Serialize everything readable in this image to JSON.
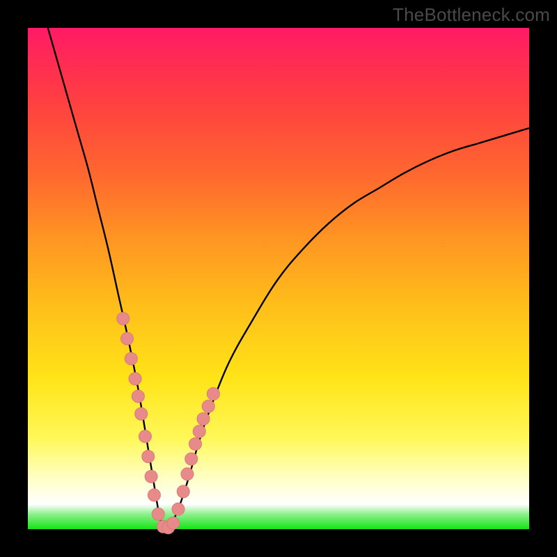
{
  "watermark": "TheBottleneck.com",
  "colors": {
    "curve_stroke": "#000000",
    "dot_fill": "#e98a8a",
    "dot_stroke": "#d97a7a"
  },
  "chart_data": {
    "type": "line",
    "title": "",
    "xlabel": "",
    "ylabel": "",
    "xlim": [
      0,
      100
    ],
    "ylim": [
      0,
      100
    ],
    "series": [
      {
        "name": "bottleneck-curve",
        "x": [
          4,
          6,
          8,
          10,
          12,
          14,
          16,
          18,
          20,
          22,
          24,
          25,
          26,
          27,
          28,
          30,
          32,
          34,
          36,
          40,
          45,
          50,
          55,
          60,
          65,
          70,
          75,
          80,
          85,
          90,
          95,
          100
        ],
        "y": [
          100,
          93,
          86,
          79,
          72,
          64,
          56,
          47,
          38,
          28,
          16,
          10,
          4,
          0,
          0,
          4,
          10,
          17,
          23,
          33,
          42,
          50,
          56,
          61,
          65,
          68,
          71,
          73.5,
          75.5,
          77,
          78.5,
          80
        ]
      }
    ],
    "dots": {
      "name": "highlight-points",
      "x": [
        19.0,
        19.8,
        20.6,
        21.4,
        22.0,
        22.6,
        23.4,
        24.0,
        24.6,
        25.2,
        26.0,
        27.0,
        28.0,
        29.0,
        30.0,
        31.0,
        31.8,
        32.6,
        33.4,
        34.2,
        35.0,
        36.0,
        37.0
      ],
      "y": [
        42.0,
        38.0,
        34.0,
        30.0,
        26.5,
        23.0,
        18.5,
        14.5,
        10.5,
        6.8,
        3.0,
        0.5,
        0.3,
        1.2,
        4.0,
        7.5,
        11.0,
        14.0,
        17.0,
        19.5,
        22.0,
        24.5,
        27.0
      ]
    }
  }
}
